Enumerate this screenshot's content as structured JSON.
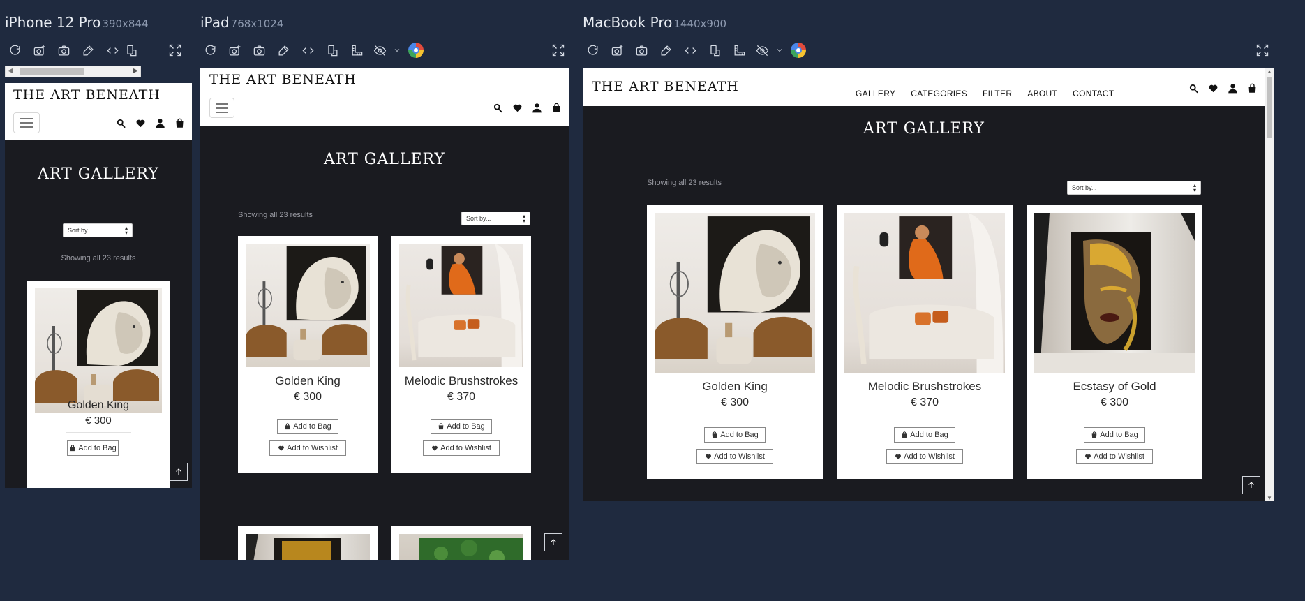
{
  "devices": [
    {
      "name": "iPhone 12 Pro",
      "dims": "390x844"
    },
    {
      "name": "iPad",
      "dims": "768x1024"
    },
    {
      "name": "MacBook Pro",
      "dims": "1440x900"
    }
  ],
  "site": {
    "logo": "THE ART BENEATH",
    "nav": [
      "GALLERY",
      "CATEGORIES",
      "FILTER",
      "ABOUT",
      "CONTACT"
    ],
    "page_title": "ART GALLERY",
    "showing": "Showing all 23 results",
    "sort_placeholder": "Sort by...",
    "add_to_bag": "Add to Bag",
    "add_to_wishlist": "Add to Wishlist"
  },
  "products": [
    {
      "name": "Golden King",
      "price": "€ 300"
    },
    {
      "name": "Melodic Brushstrokes",
      "price": "€ 370"
    },
    {
      "name": "Ecstasy of Gold",
      "price": "€ 300"
    }
  ],
  "icons": [
    "refresh-icon",
    "camera-plus-icon",
    "camera-icon",
    "eyedropper-icon",
    "code-icon",
    "rotate-device-icon",
    "ruler-icon",
    "eye-off-icon",
    "chrome-icon",
    "expand-icon",
    "search-icon",
    "heart-icon",
    "user-icon",
    "bag-icon",
    "arrow-up-icon"
  ],
  "colors": {
    "canvas": "#1f2a3f",
    "page_dark": "#1a1b20",
    "header": "#ffffff"
  }
}
